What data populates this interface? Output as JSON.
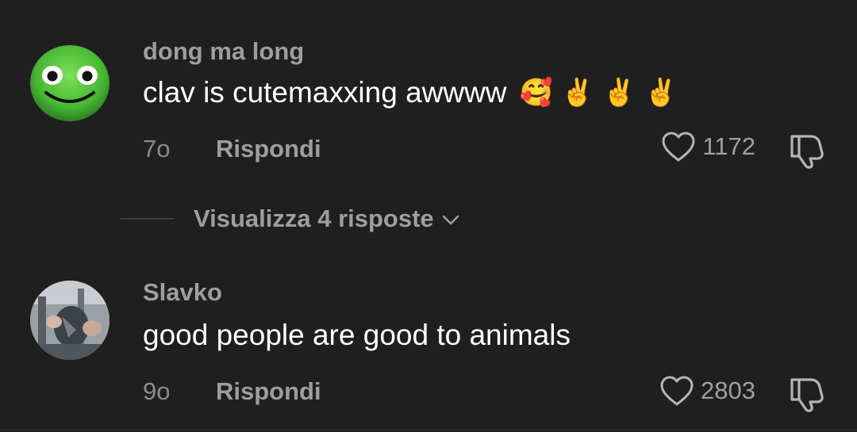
{
  "comments": [
    {
      "username": "dong ma long",
      "text": "clav is cutemaxxing awwww",
      "emojis": [
        "🥰",
        "✌️",
        "✌️",
        "✌️"
      ],
      "time": "7o",
      "reply_label": "Rispondi",
      "likes": "1172",
      "avatar_icon": "green-smiley-face"
    },
    {
      "username": "Slavko",
      "text": "good people are good to animals",
      "time": "9o",
      "reply_label": "Rispondi",
      "likes": "2803",
      "avatar_icon": "photo-avatar"
    }
  ],
  "view_replies": {
    "label": "Visualizza 4 risposte"
  },
  "colors": {
    "background": "#1f1f1f",
    "text_primary": "#ffffff",
    "text_secondary": "#9e9e9e",
    "avatar_green": "#4cc23a"
  }
}
